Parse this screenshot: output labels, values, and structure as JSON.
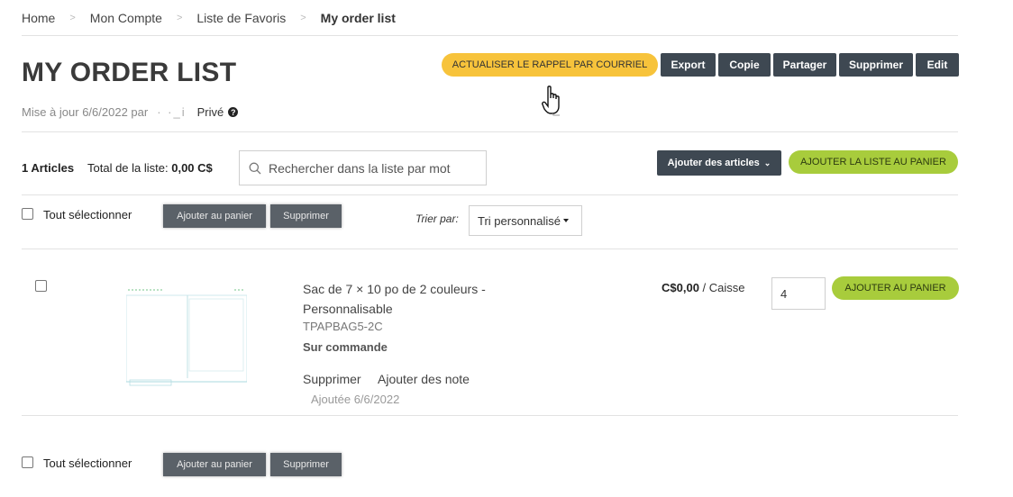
{
  "breadcrumb": [
    "Home",
    "Mon Compte",
    "Liste de Favoris",
    "My order list"
  ],
  "title": "MY ORDER LIST",
  "meta": {
    "updated": "Mise à jour 6/6/2022 par",
    "owner": "· ·_i",
    "privacy": "Privé"
  },
  "actions": {
    "reminder": "ACTUALISER LE RAPPEL PAR COURRIEL",
    "export": "Export",
    "copy": "Copie",
    "share": "Partager",
    "delete": "Supprimer",
    "edit": "Edit"
  },
  "list": {
    "count": "1 Articles",
    "total_label": "Total de la liste:",
    "total_value": "0,00 C$",
    "search_placeholder": "Rechercher dans la liste par mot",
    "add_articles": "Ajouter des articles",
    "add_list_to_cart": "AJOUTER LA LISTE AU PANIER"
  },
  "bulk": {
    "select_all": "Tout sélectionner",
    "add_to_cart": "Ajouter au panier",
    "delete": "Supprimer"
  },
  "sort": {
    "label": "Trier par:",
    "value": "Tri personnalisé"
  },
  "item": {
    "name": "Sac de 7 × 10 po de 2 couleurs - Personnalisable",
    "sku": "TPAPBAG5-2C",
    "status": "Sur commande",
    "delete": "Supprimer",
    "add_note": "Ajouter des note",
    "added": "Ajoutée 6/6/2022",
    "price": "C$0,00",
    "unit": "/ Caisse",
    "quantity": "4",
    "add_to_cart": "AJOUTER AU PANIER"
  },
  "colors": {
    "yellow": "#f7c33b",
    "dark": "#3e4852",
    "green": "#a8cc3c",
    "grey": "#5a6168"
  }
}
